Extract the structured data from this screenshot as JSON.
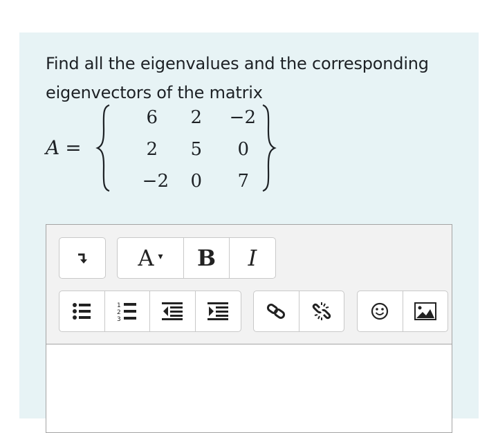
{
  "question": {
    "text": "Find all the eigenvalues and the corresponding eigenvectors of the matrix"
  },
  "matrix": {
    "name": "A",
    "equals": "=",
    "rows": [
      [
        "6",
        "2",
        "−2"
      ],
      [
        "2",
        "5",
        "0"
      ],
      [
        "−2",
        "0",
        "7"
      ]
    ]
  },
  "toolbar": {
    "row1": [
      {
        "name": "toolbar-toggle-button",
        "icon": "arrow-down-right-icon"
      },
      {
        "name": "font-style-button",
        "label": "A",
        "caret": "▾"
      },
      {
        "name": "bold-button",
        "label": "B"
      },
      {
        "name": "italic-button",
        "label": "I"
      }
    ],
    "row2": [
      {
        "name": "bullet-list-button",
        "icon": "bullet-list-icon"
      },
      {
        "name": "numbered-list-button",
        "icon": "numbered-list-icon"
      },
      {
        "name": "outdent-button",
        "icon": "outdent-icon"
      },
      {
        "name": "indent-button",
        "icon": "indent-icon"
      },
      {
        "name": "link-button",
        "icon": "link-icon"
      },
      {
        "name": "unlink-button",
        "icon": "unlink-icon"
      },
      {
        "name": "emoji-button",
        "icon": "emoji-icon"
      },
      {
        "name": "image-button",
        "icon": "image-icon"
      }
    ]
  },
  "editor": {
    "content": ""
  },
  "colors": {
    "card_background": "#e7f3f5",
    "toolbar_background": "#f2f2f2",
    "text": "#1d2125",
    "border": "#a3a3a3"
  }
}
